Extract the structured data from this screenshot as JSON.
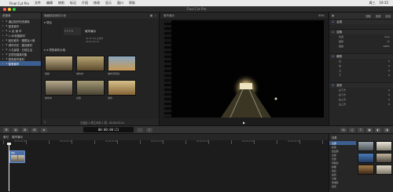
{
  "menubar": {
    "apple": "",
    "items": [
      "Final Cut Pro",
      "文件",
      "编辑",
      "修剪",
      "标记",
      "片段",
      "修改",
      "显示",
      "窗口",
      "帮助"
    ],
    "right": [
      "周三",
      "19:35"
    ]
  },
  "window": {
    "title": "Final Cut Pro"
  },
  "libraries": {
    "header": "资源库",
    "items": [
      {
        "label": "通过制作的资源库",
        "expanded": true,
        "selected": false
      },
      {
        "label": "智慧城市",
        "expanded": true,
        "selected": false
      },
      {
        "label": "人 民 城 市",
        "expanded": false,
        "selected": false
      },
      {
        "label": "1.4K拍摄素材",
        "expanded": false,
        "selected": false
      },
      {
        "label": "航拍城市 · 雕塑及人像",
        "expanded": false,
        "selected": false
      },
      {
        "label": "城市历史 · 建设素材",
        "expanded": false,
        "selected": false
      },
      {
        "label": "人文景观 · 日常生活",
        "expanded": false,
        "selected": false
      },
      {
        "label": "空镜拍摄素材集",
        "expanded": false,
        "selected": false
      },
      {
        "label": "智慧城市素材",
        "expanded": false,
        "selected": false
      },
      {
        "label": "智慧城市",
        "expanded": false,
        "selected": true
      }
    ]
  },
  "browser": {
    "filter": "隐藏被拒绝的片段",
    "group_project": "项目",
    "project": {
      "name": "城市演示",
      "meta": [
        "4K 25 fps 立体声",
        "00:00:03:21"
      ]
    },
    "group_clips": "4 项的事件片段",
    "clips": [
      {
        "caption": "地铁",
        "colors": [
          "#c7b58d",
          "#50432d"
        ]
      },
      {
        "caption": "城市中",
        "colors": [
          "#b7a473",
          "#5d4c2c"
        ]
      },
      {
        "caption": "城市天际线",
        "colors": [
          "#8aa6c1",
          "#c89a55"
        ]
      },
      {
        "caption": "城市中",
        "colors": [
          "#b6aa8d",
          "#4c4336"
        ]
      },
      {
        "caption": "古建",
        "colors": [
          "#a59a76",
          "#4b4433"
        ]
      },
      {
        "caption": "城市",
        "colors": [
          "#d7c38c",
          "#866436"
        ]
      }
    ],
    "footer": {
      "left": "1",
      "center": "已选定 4 项之中的 1 项，00:00:03:21"
    }
  },
  "viewer": {
    "label": "城市演示",
    "right": "65%",
    "controls": [
      "▶"
    ]
  },
  "inspector": {
    "tabs": [
      "视频",
      "音频",
      "信息"
    ],
    "header_label": "视频",
    "sections": [
      {
        "title": "合成",
        "rows": []
      },
      {
        "title": "变换",
        "rows": [
          {
            "label": "位置",
            "value": "0 px"
          },
          {
            "label": "旋转",
            "value": "0°"
          },
          {
            "label": "缩放",
            "value": "100%"
          }
        ]
      },
      {
        "title": "裁剪",
        "rows": [
          {
            "label": "左",
            "value": "0"
          },
          {
            "label": "右",
            "value": "0"
          },
          {
            "label": "上",
            "value": "0"
          },
          {
            "label": "下",
            "value": "0"
          }
        ]
      },
      {
        "title": "变形",
        "rows": [
          {
            "label": "左下方",
            "value": "0"
          },
          {
            "label": "右下方",
            "value": "0"
          },
          {
            "label": "右上方",
            "value": "0"
          },
          {
            "label": "左上方",
            "value": "0"
          }
        ]
      }
    ]
  },
  "toolbar": {
    "timecode": "00:00:00:21",
    "right_buttons": [
      "fx",
      "♫",
      "T",
      "▣",
      "◧",
      "◨"
    ]
  },
  "timeline": {
    "index": "索引",
    "project": "城市演示",
    "ruler_labels": [
      "00:00:00:00",
      "00:00:00:15",
      "00:00:01:05",
      "00:00:01:20",
      "00:00:02:10",
      "00:00:03:00",
      "00:00:03:15",
      "00:00:04:05"
    ],
    "clip_label": "地铁"
  },
  "effects_browser": {
    "header": "效果",
    "items": [
      {
        "label": "全部",
        "selected": true
      },
      {
        "label": "标题",
        "selected": false
      },
      {
        "label": "发生器",
        "selected": false
      },
      {
        "label": "主题",
        "selected": false
      },
      {
        "label": "光源",
        "selected": false
      },
      {
        "label": "风格化",
        "selected": false
      },
      {
        "label": "模糊",
        "selected": false
      },
      {
        "label": "色彩",
        "selected": false
      },
      {
        "label": "失真",
        "selected": false
      },
      {
        "label": "平铺",
        "selected": false
      },
      {
        "label": "老电影",
        "selected": false
      },
      {
        "label": "遮罩",
        "selected": false
      }
    ],
    "thumb_colors": [
      [
        "#9aa6ad",
        "#4e5459"
      ],
      [
        "#e8e4d7",
        "#8a8579"
      ],
      [
        "#4a7cb8",
        "#233b62"
      ],
      [
        "#c2b7a0",
        "#4d473e"
      ],
      [
        "#a77c4b",
        "#3b2a19"
      ],
      [
        "#dcd7c4",
        "#7f7a6c"
      ]
    ]
  },
  "colors": {
    "accent": "#3c5f92",
    "clip": "#4b6fa8",
    "menubar": "#e9e9e9",
    "panel": "#262626"
  }
}
